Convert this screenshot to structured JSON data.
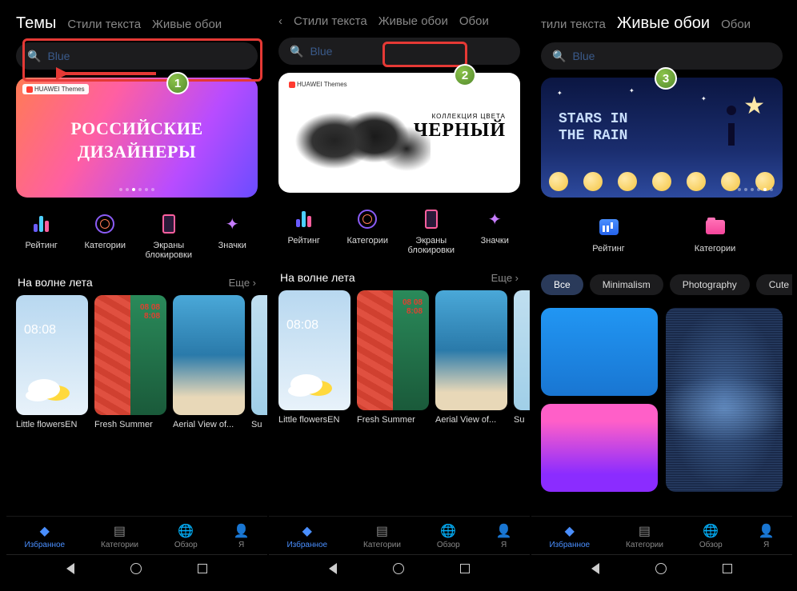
{
  "tabs": {
    "themes": "Темы",
    "textStyles": "Стили текста",
    "liveWallpapers": "Живые обои",
    "wallpapers": "Обои",
    "textStylesPartial": "тили текста",
    "leftChevron": "‹"
  },
  "search": {
    "placeholder": "Blue"
  },
  "banners": {
    "tag": "HUAWEI Themes",
    "b1_line1": "Российские",
    "b1_line2": "Дизайнеры",
    "b2_sub": "КОЛЛЕКЦИЯ ЦВЕТА",
    "b2_main": "ЧЕРНЫЙ",
    "b3_line1": "Stars in",
    "b3_line2": "the Rain"
  },
  "categories": {
    "rating": "Рейтинг",
    "categories": "Категории",
    "lockscreens": "Экраны блокировки",
    "icons": "Значки"
  },
  "section": {
    "summerWave": "На волне лета",
    "more": "Еще"
  },
  "thumbs": {
    "t1": "Little flowersEN",
    "t2": "Fresh Summer",
    "t3": "Aerial View of...",
    "t4": "Su"
  },
  "chips": {
    "all": "Все",
    "minimalism": "Minimalism",
    "photography": "Photography",
    "cute": "Cute"
  },
  "bottomnav": {
    "featured": "Избранное",
    "categories": "Категории",
    "browse": "Обзор",
    "me": "Я"
  },
  "badges": {
    "n1": "1",
    "n2": "2",
    "n3": "3"
  }
}
